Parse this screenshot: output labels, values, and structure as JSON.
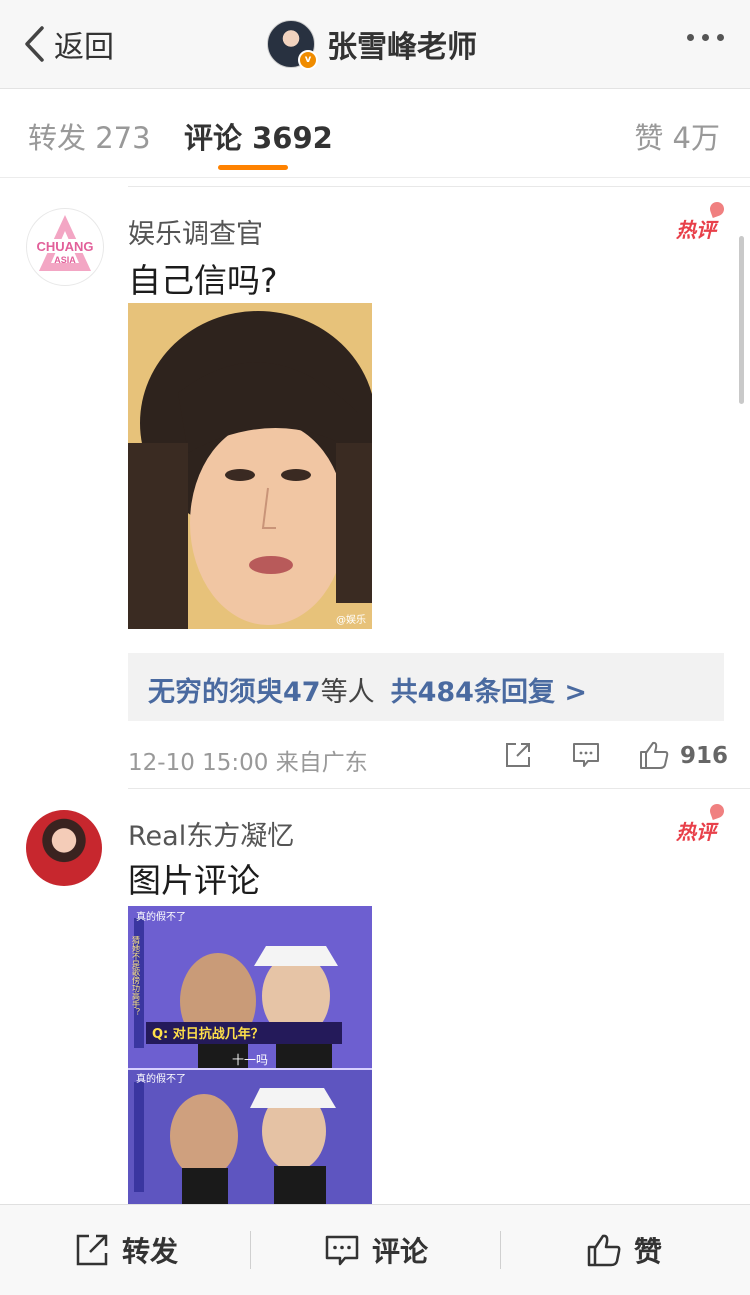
{
  "header": {
    "back_label": "返回",
    "title": "张雪峰老师",
    "verified_badge": "v",
    "more_icon": "more-dots-icon"
  },
  "tabs": {
    "repost": "转发 273",
    "comments": "评论 3692",
    "likes": "赞 4万"
  },
  "comments": [
    {
      "username": "娱乐调查官",
      "avatar_text": "CHUANG ASIA",
      "badge": "热评",
      "text": "自己信吗?",
      "image_watermark": "@娱乐",
      "replies": {
        "name": "无穷的须臾47",
        "mid": "等人",
        "total": "共484条回复 >"
      },
      "meta": "12-10 15:00  来自广东",
      "like_count": "916"
    },
    {
      "username": "Real东方凝忆",
      "badge": "热评",
      "text": "图片评论",
      "image_caption_top": "真的假不了",
      "image_side_text": "猜她不是歌傍功高手？",
      "image_question": "Q: 对日抗战几年？",
      "image_answer": "十一吗",
      "image_caption_bottom": "真的假不了"
    }
  ],
  "bottom_bar": {
    "repost": "转发",
    "comment": "评论",
    "like": "赞"
  },
  "colors": {
    "accent": "#ff8200",
    "link": "#4a6aa0",
    "hot": "#e8404a"
  }
}
